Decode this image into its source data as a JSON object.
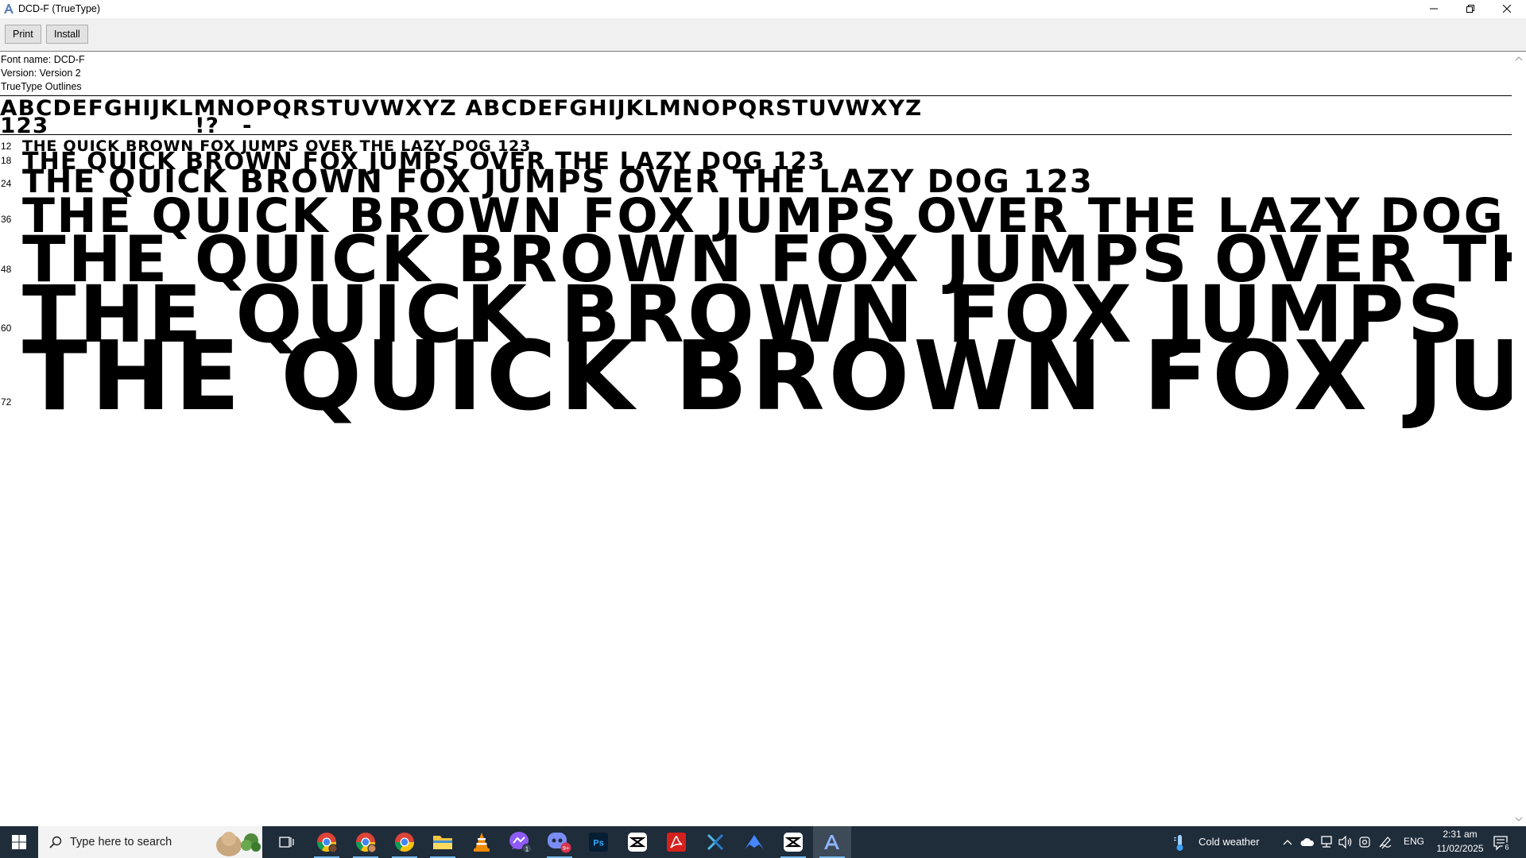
{
  "window": {
    "title": "DCD-F (TrueType)"
  },
  "toolbar": {
    "print_label": "Print",
    "install_label": "Install"
  },
  "font_info": {
    "name_line": "Font name: DCD-F",
    "version_line": "Version: Version 2",
    "outline_line": "TrueType Outlines"
  },
  "charset": {
    "line1": "ABCDEFGHIJKLMNOPQRSTUVWXYZ ABCDEFGHIJKLMNOPQRSTUVWXYZ",
    "line2": "123",
    "punct1": "!?",
    "punct2": "-"
  },
  "samples": [
    {
      "size": "12",
      "text": "THE QUICK BROWN FOX JUMPS OVER THE LAZY DOG  123"
    },
    {
      "size": "18",
      "text": "THE QUICK BROWN FOX JUMPS OVER THE LAZY DOG  123"
    },
    {
      "size": "24",
      "text": "THE QUICK BROWN FOX JUMPS OVER THE LAZY DOG  123"
    },
    {
      "size": "36",
      "text": "THE QUICK BROWN FOX JUMPS OVER THE LAZY DOG"
    },
    {
      "size": "48",
      "text": "THE QUICK BROWN FOX JUMPS OVER TH"
    },
    {
      "size": "60",
      "text": "THE QUICK BROWN FOX JUMPS"
    },
    {
      "size": "72",
      "text": "THE QUICK BROWN FOX JU"
    }
  ],
  "taskbar": {
    "search_placeholder": "Type here to search",
    "weather": "Cold weather",
    "language": "ENG",
    "time": "2:31 am",
    "date": "11/02/2025",
    "notification_count": "6",
    "apps": [
      {
        "name": "task-view-icon"
      },
      {
        "name": "chrome-profile-1-icon"
      },
      {
        "name": "chrome-profile-2-icon"
      },
      {
        "name": "chrome-icon"
      },
      {
        "name": "file-explorer-icon"
      },
      {
        "name": "vlc-icon"
      },
      {
        "name": "messenger-icon",
        "badge": "1"
      },
      {
        "name": "discord-icon",
        "badge": "9+"
      },
      {
        "name": "photoshop-icon",
        "label": "Ps"
      },
      {
        "name": "capcut-icon"
      },
      {
        "name": "acrobat-icon"
      },
      {
        "name": "app-icon"
      },
      {
        "name": "nordvpn-icon"
      },
      {
        "name": "capcut-2-icon"
      },
      {
        "name": "font-viewer-icon"
      }
    ]
  },
  "colors": {
    "taskbar_bg": "#1f2c3a",
    "toolbar_bg": "#f0f0f0",
    "accent": "#76b9ed"
  }
}
